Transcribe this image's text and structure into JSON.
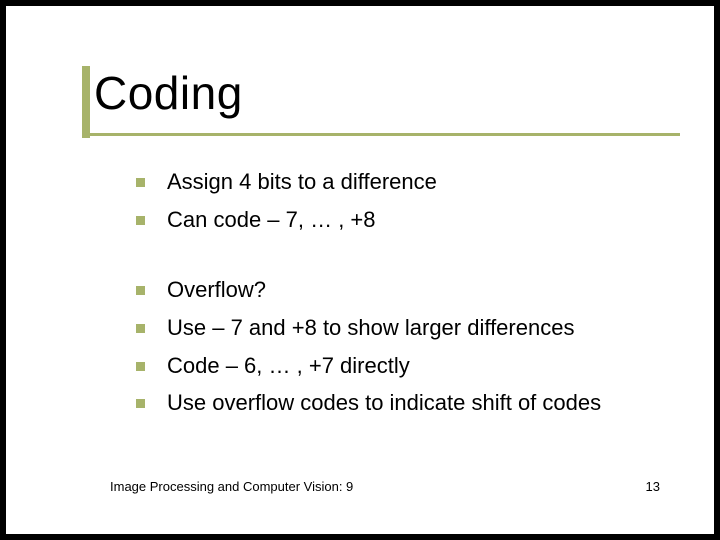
{
  "title": "Coding",
  "group1": [
    "Assign 4 bits to a difference",
    "Can code – 7, … , +8"
  ],
  "group2": [
    "Overflow?",
    "Use – 7 and +8 to show larger differences",
    "Code – 6, … , +7 directly",
    "Use overflow codes to indicate shift of codes"
  ],
  "footer_left": "Image Processing and Computer Vision: 9",
  "footer_right": "13"
}
